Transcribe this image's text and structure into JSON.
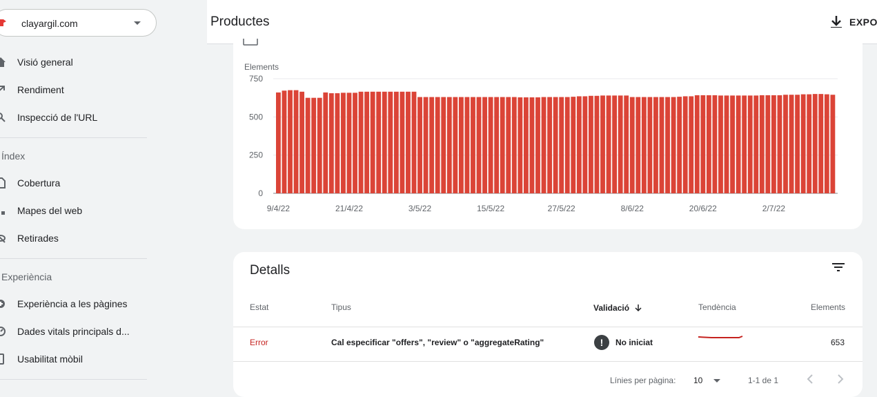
{
  "sidebar": {
    "property": "clayargil.com",
    "items": [
      {
        "label": "Visió general",
        "icon": "home-icon"
      },
      {
        "label": "Rendiment",
        "icon": "trending-up-icon"
      },
      {
        "label": "Inspecció de l'URL",
        "icon": "search-icon"
      }
    ],
    "sections": [
      {
        "title": "Índex",
        "items": [
          {
            "label": "Cobertura",
            "icon": "file-icon"
          },
          {
            "label": "Mapes del web",
            "icon": "sitemap-icon"
          },
          {
            "label": "Retirades",
            "icon": "visibility-off-icon"
          }
        ]
      },
      {
        "title": "Experiència",
        "items": [
          {
            "label": "Experiència a les pàgines",
            "icon": "add-circle-icon"
          },
          {
            "label": "Dades vitals principals d...",
            "icon": "speed-icon"
          },
          {
            "label": "Usabilitat mòbil",
            "icon": "phone-icon"
          }
        ]
      }
    ]
  },
  "header": {
    "title": "Productes",
    "export_label": "EXPOR"
  },
  "chart_data": {
    "type": "bar",
    "ylabel": "Elements",
    "ylim": [
      0,
      750
    ],
    "yticks": [
      0,
      250,
      500,
      750
    ],
    "color": "#db4437",
    "x_tick_labels": [
      "9/4/22",
      "21/4/22",
      "3/5/22",
      "15/5/22",
      "27/5/22",
      "8/6/22",
      "20/6/22",
      "2/7/22"
    ],
    "x_tick_index": [
      0,
      12,
      24,
      36,
      48,
      60,
      72,
      84
    ],
    "values": [
      660,
      672,
      675,
      675,
      665,
      625,
      625,
      625,
      660,
      655,
      655,
      658,
      658,
      658,
      665,
      665,
      665,
      665,
      665,
      665,
      665,
      665,
      665,
      665,
      630,
      630,
      630,
      630,
      630,
      630,
      630,
      630,
      630,
      630,
      630,
      630,
      630,
      630,
      630,
      630,
      630,
      628,
      628,
      628,
      628,
      630,
      630,
      630,
      630,
      630,
      632,
      635,
      635,
      638,
      638,
      640,
      640,
      640,
      640,
      640,
      630,
      630,
      630,
      630,
      630,
      630,
      630,
      630,
      632,
      635,
      635,
      642,
      642,
      642,
      642,
      640,
      640,
      640,
      640,
      640,
      640,
      640,
      642,
      642,
      642,
      642,
      645,
      645,
      645,
      648,
      648,
      650,
      650,
      648,
      645
    ]
  },
  "details": {
    "title": "Detalls",
    "columns": {
      "status": "Estat",
      "type": "Tipus",
      "validation": "Validació",
      "trend": "Tendència",
      "elements": "Elements"
    },
    "rows": [
      {
        "status": "Error",
        "type": "Cal especificar \"offers\", \"review\" o \"aggregateRating\"",
        "validation": "No iniciat",
        "elements": "653"
      }
    ],
    "footer": {
      "rows_per_page_label": "Línies per pàgina:",
      "rows_per_page": "10",
      "range": "1-1 de 1"
    }
  }
}
